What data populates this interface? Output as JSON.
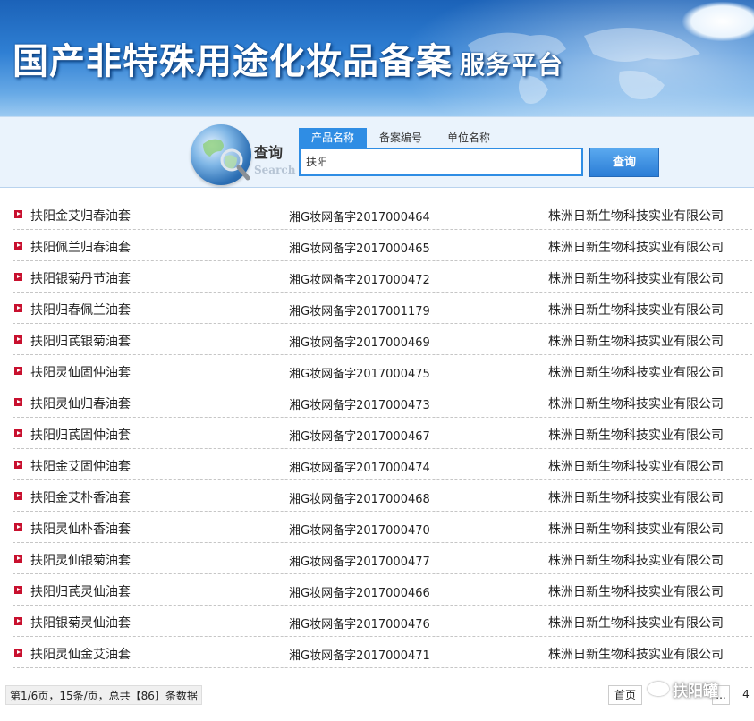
{
  "header": {
    "title": "国产非特殊用途化妆品备案",
    "subtitle": "服务平台"
  },
  "search": {
    "caption_cn": "查询",
    "caption_en": "Search",
    "tabs": [
      {
        "label": "产品名称",
        "active": true
      },
      {
        "label": "备案编号",
        "active": false
      },
      {
        "label": "单位名称",
        "active": false
      }
    ],
    "query": "扶阳",
    "button_label": "查询"
  },
  "results": [
    {
      "name": "扶阳金艾归春油套",
      "reg_no": "湘G妆网备字2017000464",
      "company": "株洲日新生物科技实业有限公司"
    },
    {
      "name": "扶阳佩兰归春油套",
      "reg_no": "湘G妆网备字2017000465",
      "company": "株洲日新生物科技实业有限公司"
    },
    {
      "name": "扶阳银菊丹节油套",
      "reg_no": "湘G妆网备字2017000472",
      "company": "株洲日新生物科技实业有限公司"
    },
    {
      "name": "扶阳归春佩兰油套",
      "reg_no": "湘G妆网备字2017001179",
      "company": "株洲日新生物科技实业有限公司"
    },
    {
      "name": "扶阳归芪银菊油套",
      "reg_no": "湘G妆网备字2017000469",
      "company": "株洲日新生物科技实业有限公司"
    },
    {
      "name": "扶阳灵仙固仲油套",
      "reg_no": "湘G妆网备字2017000475",
      "company": "株洲日新生物科技实业有限公司"
    },
    {
      "name": "扶阳灵仙归春油套",
      "reg_no": "湘G妆网备字2017000473",
      "company": "株洲日新生物科技实业有限公司"
    },
    {
      "name": "扶阳归芪固仲油套",
      "reg_no": "湘G妆网备字2017000467",
      "company": "株洲日新生物科技实业有限公司"
    },
    {
      "name": "扶阳金艾固仲油套",
      "reg_no": "湘G妆网备字2017000474",
      "company": "株洲日新生物科技实业有限公司"
    },
    {
      "name": "扶阳金艾朴香油套",
      "reg_no": "湘G妆网备字2017000468",
      "company": "株洲日新生物科技实业有限公司"
    },
    {
      "name": "扶阳灵仙朴香油套",
      "reg_no": "湘G妆网备字2017000470",
      "company": "株洲日新生物科技实业有限公司"
    },
    {
      "name": "扶阳灵仙银菊油套",
      "reg_no": "湘G妆网备字2017000477",
      "company": "株洲日新生物科技实业有限公司"
    },
    {
      "name": "扶阳归芪灵仙油套",
      "reg_no": "湘G妆网备字2017000466",
      "company": "株洲日新生物科技实业有限公司"
    },
    {
      "name": "扶阳银菊灵仙油套",
      "reg_no": "湘G妆网备字2017000476",
      "company": "株洲日新生物科技实业有限公司"
    },
    {
      "name": "扶阳灵仙金艾油套",
      "reg_no": "湘G妆网备字2017000471",
      "company": "株洲日新生物科技实业有限公司"
    }
  ],
  "footer": {
    "page_info": "第1/6页，15条/页，总共【86】条数据",
    "first_label": "首页",
    "next_label": "...",
    "page_4": "4"
  },
  "watermark": {
    "text": "扶阳罐"
  },
  "colors": {
    "accent": "#2f8de4",
    "bullet": "#c8102e",
    "banner": "#2f7fd3"
  }
}
